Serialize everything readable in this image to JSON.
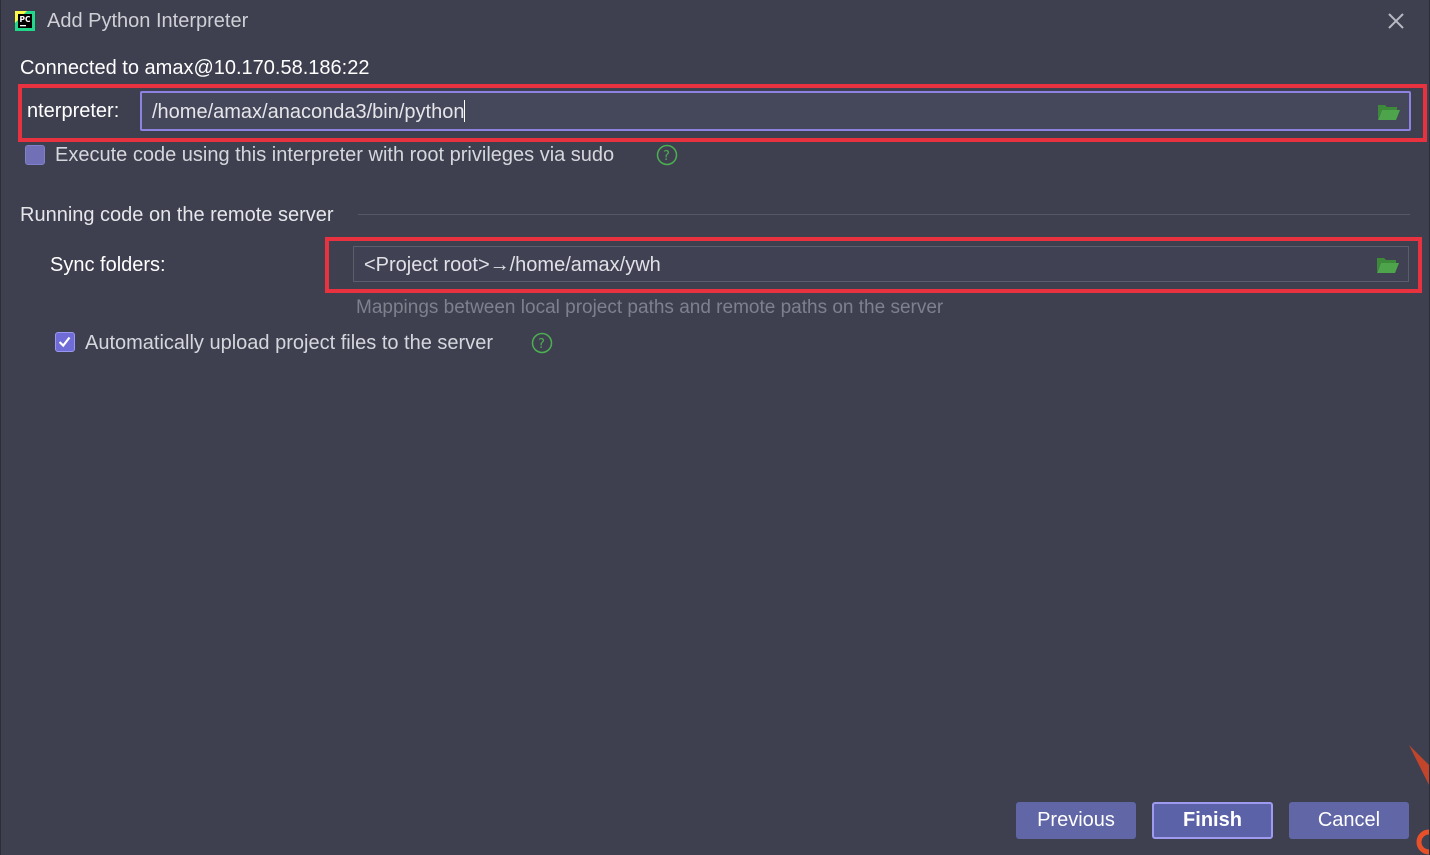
{
  "window": {
    "title": "Add Python Interpreter",
    "app_icon_text": "PC",
    "close_glyph": "×"
  },
  "connection": {
    "text": "Connected to amax@10.170.58.186:22"
  },
  "interpreter": {
    "label": "nterpreter:",
    "value": "/home/amax/anaconda3/bin/python",
    "browse_icon": "folder-open-icon"
  },
  "sudo_option": {
    "label": "Execute code using this interpreter with root privileges via sudo",
    "checked": false,
    "help_glyph": "?"
  },
  "remote_section": {
    "title": "Running code on the remote server",
    "sync": {
      "label": "Sync folders:",
      "value": "<Project root>→/home/amax/ywh",
      "hint": "Mappings between local project paths and remote paths on the server",
      "browse_icon": "folder-open-icon"
    },
    "auto_upload": {
      "label": "Automatically upload project files to the server",
      "checked": true,
      "help_glyph": "?"
    }
  },
  "buttons": {
    "previous": "Previous",
    "finish": "Finish",
    "cancel": "Cancel"
  },
  "colors": {
    "background": "#3e4050",
    "highlight": "#e8323f",
    "accent": "#8e82e0",
    "help_green": "#4caf50",
    "folder_green": "#4ea44a"
  }
}
